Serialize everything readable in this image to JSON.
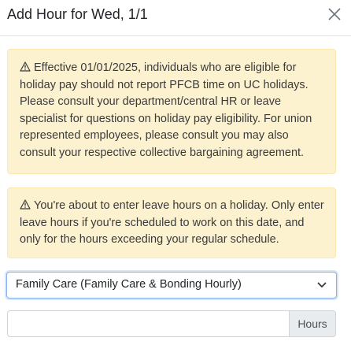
{
  "dialog": {
    "title": "Add Hour for Wed, 1/1",
    "close_icon": "close-icon"
  },
  "alerts": [
    {
      "icon": "warning-icon",
      "text": "Effective 01/01/2025, individuals who are eligible for holiday pay should not report PFCB time on UC holidays. Please consult your department/central HR or leave specialist for questions on holiday pay eligibility. For union represented employees, please consult you may also consult your respective collective bargaining agreement."
    },
    {
      "icon": "warning-icon",
      "text": "You're about to enter leave hours on a holiday. Only enter leave hours if you're scheduled to work on this date, and only for the hours exceeding your regular schedule."
    }
  ],
  "leave_type": {
    "selected": "Family Care (Family Care & Bonding Hourly)",
    "icon": "chevron-down-icon"
  },
  "hours": {
    "value": "",
    "placeholder": "",
    "addon_label": "Hours"
  },
  "colors": {
    "alert_bg": "#fdf2d0",
    "select_focus": "#8ab2e8",
    "addon_bg": "#e9ecef"
  }
}
